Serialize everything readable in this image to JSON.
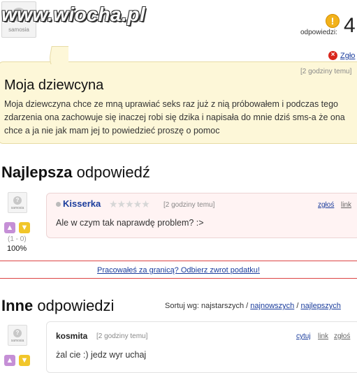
{
  "watermark": "www.wiocha.pl",
  "header": {
    "avatar_label": "samosia",
    "answers_label": "odpowiedzi:",
    "answers_count": "4",
    "report_label": "Zgło"
  },
  "question": {
    "time": "[2 godziny temu]",
    "title": "Moja dziewcyna",
    "body": "Moja dziewczyna chce ze mną uprawiać seks raz już z nią próbowałem i podczas tego zdarzenia ona zachowuje się inaczej robi się dzika i napisała do mnie dziś sms-a że ona chce a ja nie jak mam jej to powiedzieć proszę o pomoc"
  },
  "best_answer": {
    "heading_bold": "Najlepsza",
    "heading_rest": "odpowiedź",
    "user": "Kisserka",
    "rating_stars": "★★★★★",
    "time": "[2 godziny temu]",
    "report": "zgłoś",
    "link": "link",
    "text": "Ale w czym tak naprawdę problem? :>",
    "votes": "(1 - 0)",
    "percent": "100%",
    "avatar_label": "samosia"
  },
  "ad": {
    "text": "Pracowałeś za granicą? Odbierz zwrot podatku!"
  },
  "other_answers": {
    "heading_bold": "Inne",
    "heading_rest": "odpowiedzi",
    "sort_label": "Sortuj wg: najstarszych /",
    "sort_newest": "najnowszych",
    "sort_sep": "/",
    "sort_best": "najlepszych",
    "items": [
      {
        "user": "kosmita",
        "time": "[2 godziny temu]",
        "quote": "cytuj",
        "link": "link",
        "report": "zgłoś",
        "text": "żal cie :) jedz wyr uchaj",
        "avatar_label": "samosia"
      }
    ]
  },
  "colors": {
    "question_bg": "#fdf7d8",
    "link_blue": "#1a3c9c",
    "best_bg": "#fff3f3",
    "ad_border": "#dd4444"
  }
}
